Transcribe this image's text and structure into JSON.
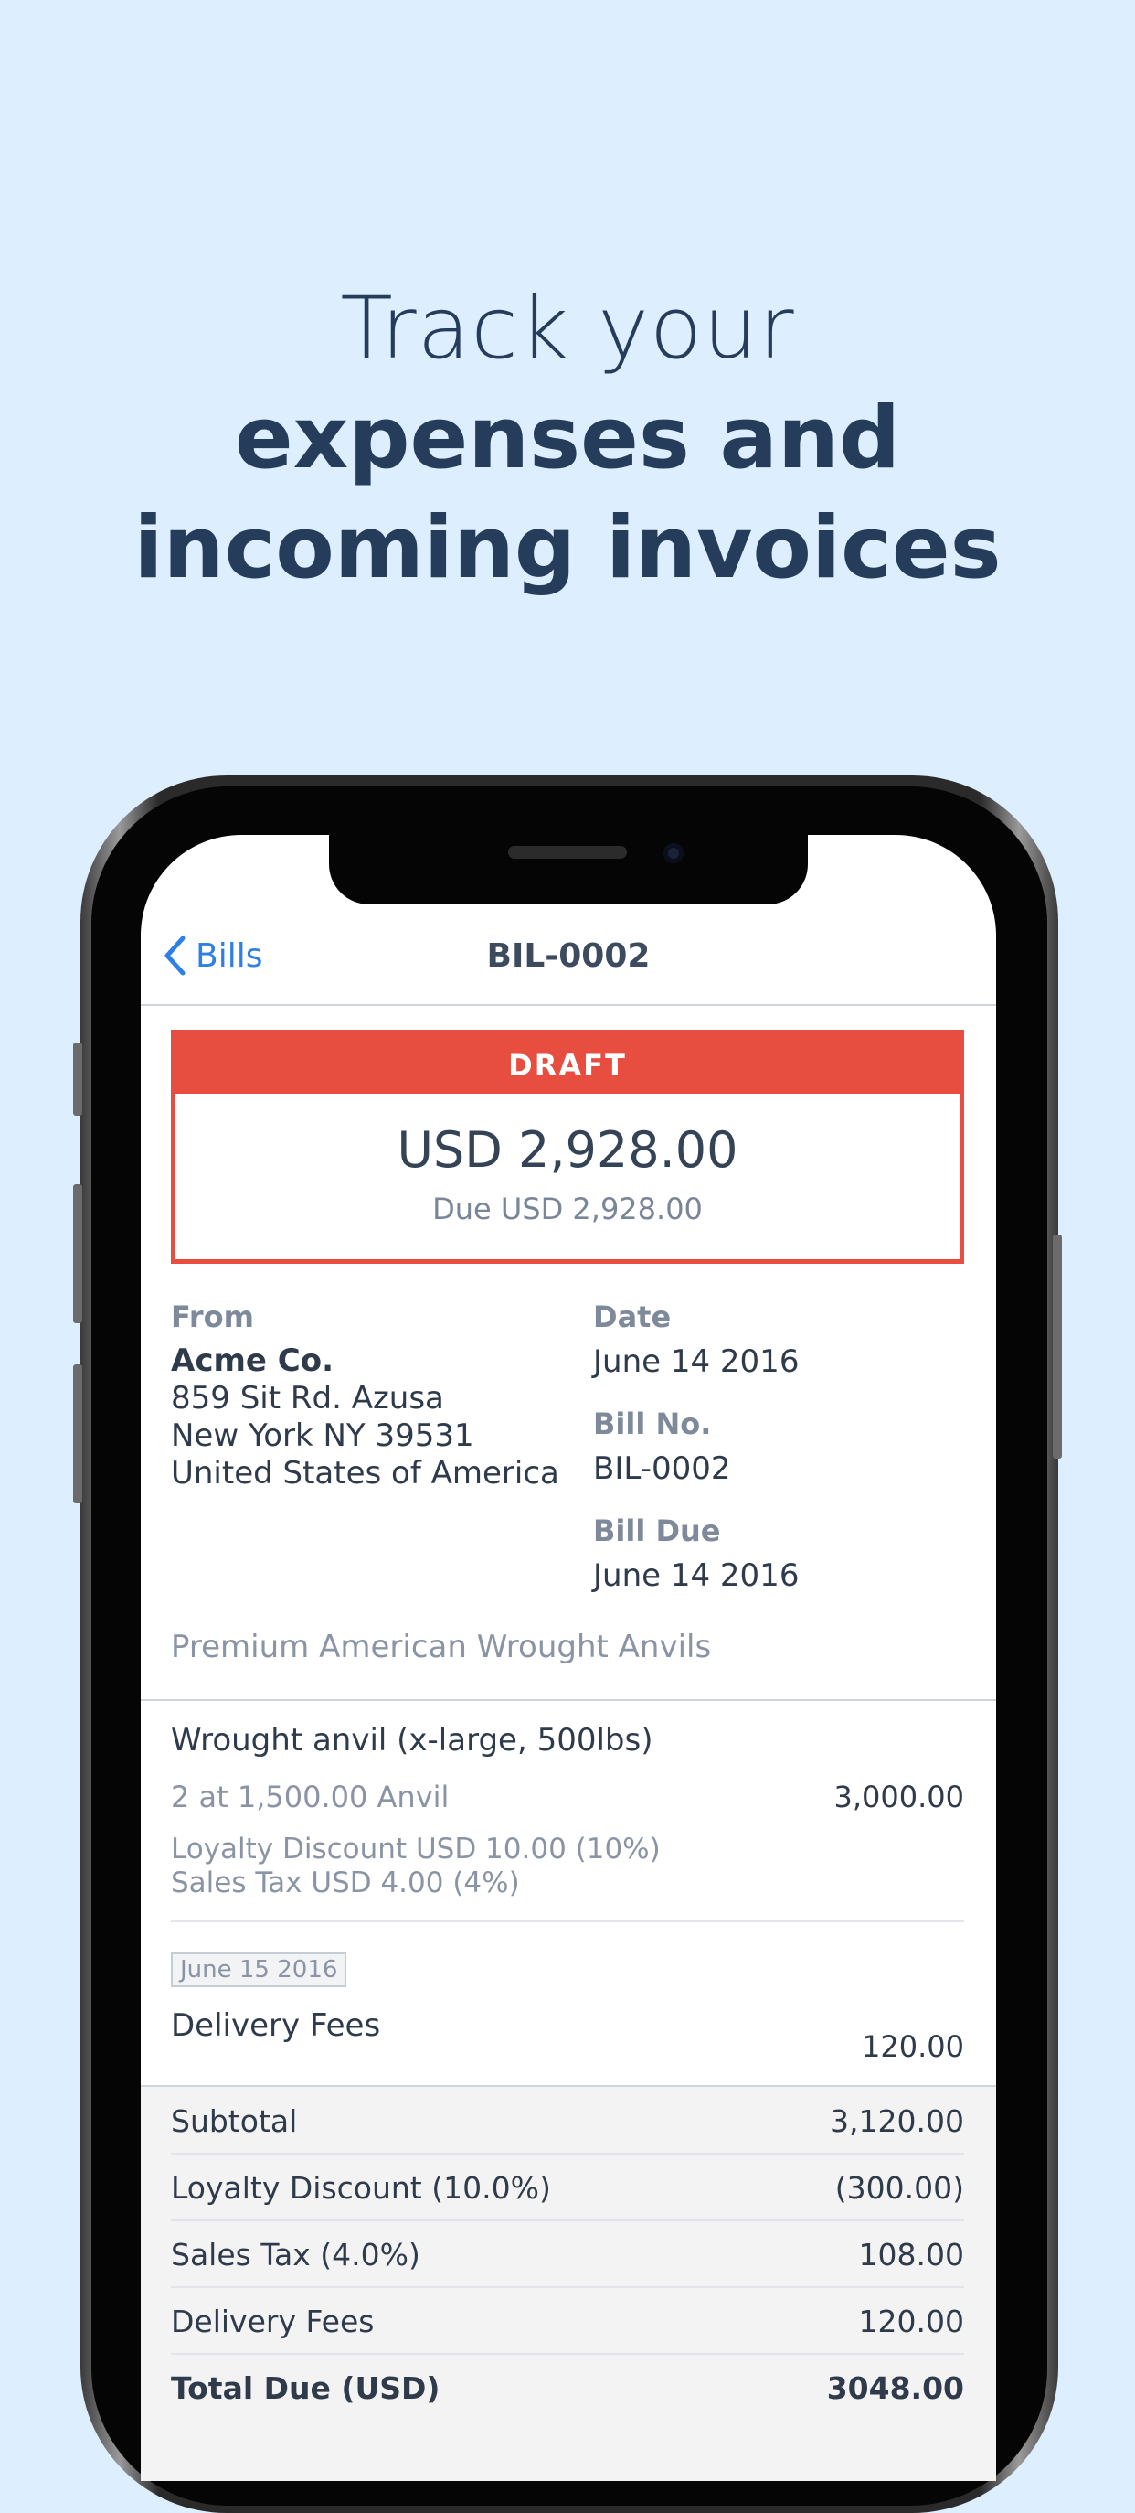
{
  "headline": {
    "line1": "Track your",
    "line2": "expenses and",
    "line3": "incoming invoices"
  },
  "nav": {
    "back_label": "Bills",
    "title": "BIL-0002"
  },
  "status": {
    "label": "DRAFT",
    "amount": "USD 2,928.00",
    "due": "Due USD 2,928.00",
    "color": "#e84e40"
  },
  "details": {
    "from_label": "From",
    "from_name": "Acme Co.",
    "address_line1": "859 Sit Rd. Azusa",
    "address_line2": "New York NY 39531",
    "address_line3": "United States of America",
    "date_label": "Date",
    "date": "June 14 2016",
    "bill_no_label": "Bill No.",
    "bill_no": "BIL-0002",
    "bill_due_label": "Bill Due",
    "bill_due": "June 14 2016",
    "description": "Premium American Wrought Anvils"
  },
  "line_item": {
    "name": "Wrought anvil (x-large, 500lbs)",
    "qty": "2 at 1,500.00 Anvil",
    "amount": "3,000.00",
    "discount": "Loyalty Discount USD 10.00 (10%)",
    "tax": "Sales Tax USD 4.00 (4%)"
  },
  "fee_item": {
    "date": "June 15 2016",
    "name": "Delivery Fees",
    "amount": "120.00"
  },
  "totals": [
    {
      "label": "Subtotal",
      "value": "3,120.00"
    },
    {
      "label": "Loyalty Discount (10.0%)",
      "value": "(300.00)"
    },
    {
      "label": "Sales Tax (4.0%)",
      "value": "108.00"
    },
    {
      "label": "Delivery Fees",
      "value": "120.00"
    },
    {
      "label": "Total Due (USD)",
      "value": "3048.00"
    }
  ],
  "colors": {
    "background": "#ddeefe",
    "accent": "#2f80e6",
    "headline": "#253d5b"
  }
}
